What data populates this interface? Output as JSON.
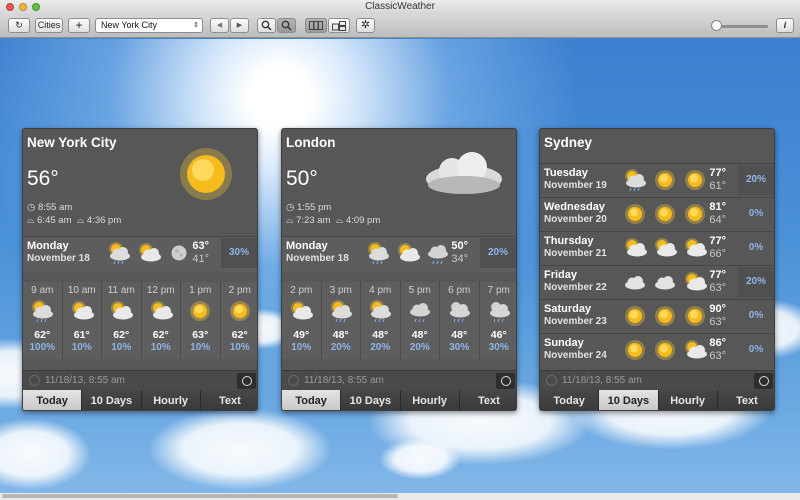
{
  "app": {
    "title": "ClassicWeather"
  },
  "toolbar": {
    "refresh_icon": "refresh-icon",
    "cities_label": "Cities",
    "add_label": "+",
    "selected_city": "New York City",
    "back_label": "◀",
    "forward_label": "▶",
    "info_label": "i"
  },
  "status_stamp": "11/18/13, 8:55 am",
  "tabs": [
    "Today",
    "10 Days",
    "Hourly",
    "Text"
  ],
  "cities": [
    {
      "name": "New York City",
      "temp": "56°",
      "time": "8:55 am",
      "sunrise": "6:45 am",
      "sunset": "4:36 pm",
      "active_tab": "Today",
      "today": {
        "day": "Monday",
        "date": "November 18",
        "hi": "63°",
        "lo": "41°",
        "precip": "30%"
      },
      "hourly": [
        {
          "time": "9 am",
          "temp": "62°",
          "precip": "100%"
        },
        {
          "time": "10 am",
          "temp": "61°",
          "precip": "10%"
        },
        {
          "time": "11 am",
          "temp": "62°",
          "precip": "10%"
        },
        {
          "time": "12 pm",
          "temp": "62°",
          "precip": "10%"
        },
        {
          "time": "1 pm",
          "temp": "63°",
          "precip": "10%"
        },
        {
          "time": "2 pm",
          "temp": "62°",
          "precip": "10%"
        }
      ]
    },
    {
      "name": "London",
      "temp": "50°",
      "time": "1:55 pm",
      "sunrise": "7:23 am",
      "sunset": "4:09 pm",
      "active_tab": "Today",
      "today": {
        "day": "Monday",
        "date": "November 18",
        "hi": "50°",
        "lo": "34°",
        "precip": "20%"
      },
      "hourly": [
        {
          "time": "2 pm",
          "temp": "49°",
          "precip": "10%"
        },
        {
          "time": "3 pm",
          "temp": "48°",
          "precip": "20%"
        },
        {
          "time": "4 pm",
          "temp": "48°",
          "precip": "20%"
        },
        {
          "time": "5 pm",
          "temp": "48°",
          "precip": "20%"
        },
        {
          "time": "6 pm",
          "temp": "48°",
          "precip": "30%"
        },
        {
          "time": "7 pm",
          "temp": "46°",
          "precip": "30%"
        }
      ]
    },
    {
      "name": "Sydney",
      "active_tab": "10 Days",
      "days": [
        {
          "day": "Tuesday",
          "date": "November 19",
          "hi": "77°",
          "lo": "61°",
          "precip": "20%"
        },
        {
          "day": "Wednesday",
          "date": "November 20",
          "hi": "81°",
          "lo": "64°",
          "precip": "0%"
        },
        {
          "day": "Thursday",
          "date": "November 21",
          "hi": "77°",
          "lo": "66°",
          "precip": "0%"
        },
        {
          "day": "Friday",
          "date": "November 22",
          "hi": "77°",
          "lo": "63°",
          "precip": "20%"
        },
        {
          "day": "Saturday",
          "date": "November 23",
          "hi": "90°",
          "lo": "63°",
          "precip": "0%"
        },
        {
          "day": "Sunday",
          "date": "November 24",
          "hi": "86°",
          "lo": "63°",
          "precip": "0%"
        }
      ]
    }
  ],
  "colors": {
    "sky": "#3f86d0",
    "panel": "#575757",
    "precip": "#8fb5e8",
    "sun": "#f7c21c"
  }
}
